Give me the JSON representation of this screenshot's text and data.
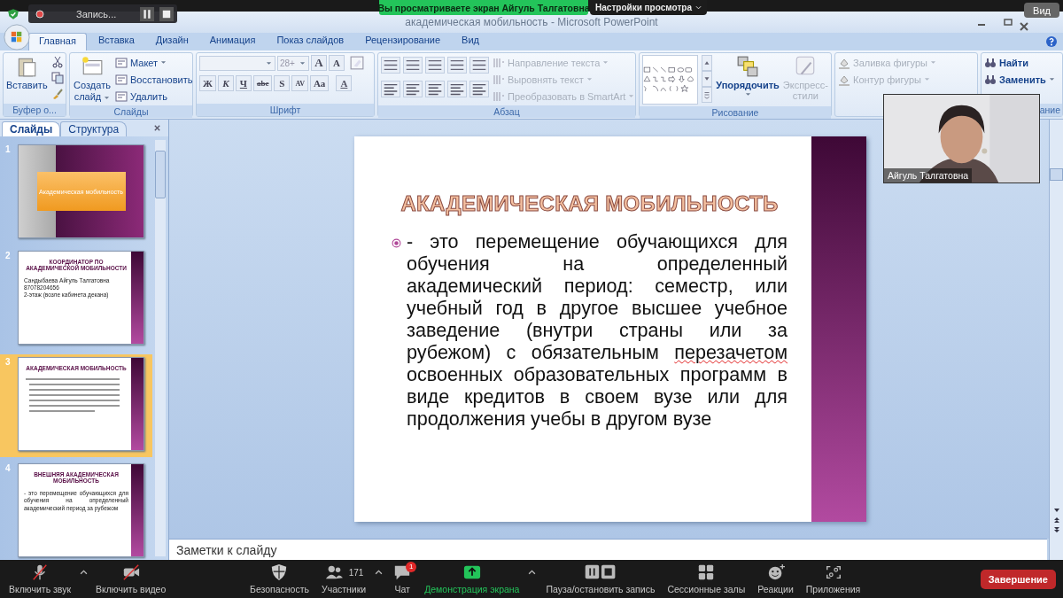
{
  "zoom_bar": {
    "banner": "Вы просматриваете экран Айгуль Талгатовна",
    "view_options": "Настройки просмотра",
    "view": "Вид"
  },
  "recording": {
    "label": "Запись..."
  },
  "window": {
    "title": "академическая мобильность - Microsoft PowerPoint"
  },
  "tabs": [
    {
      "label": "Главная",
      "selected": true
    },
    {
      "label": "Вставка",
      "selected": false
    },
    {
      "label": "Дизайн",
      "selected": false
    },
    {
      "label": "Анимация",
      "selected": false
    },
    {
      "label": "Показ слайдов",
      "selected": false
    },
    {
      "label": "Рецензирование",
      "selected": false
    },
    {
      "label": "Вид",
      "selected": false
    }
  ],
  "ribbon": {
    "clipboard": {
      "label": "Буфер о...",
      "paste": "Вставить"
    },
    "slides": {
      "label": "Слайды",
      "new_slide": "Создать слайд",
      "items": [
        {
          "label": "Макет",
          "dropdown": true
        },
        {
          "label": "Восстановить",
          "dropdown": false
        },
        {
          "label": "Удалить",
          "dropdown": false
        }
      ]
    },
    "font": {
      "label": "Шрифт",
      "size": "28+",
      "size_buttons": [
        "A",
        "A"
      ],
      "buttons": [
        "Ж",
        "К",
        "Ч",
        "abe",
        "S",
        "AV",
        "Aa",
        "A"
      ]
    },
    "paragraph": {
      "label": "Абзац",
      "items": [
        {
          "label": "Направление текста",
          "disabled": true
        },
        {
          "label": "Выровнять текст",
          "disabled": true
        },
        {
          "label": "Преобразовать в SmartArt",
          "disabled": true
        }
      ]
    },
    "drawing": {
      "label": "Рисование",
      "arrange": "Упорядочить",
      "quick_styles": {
        "label": "Экспресс-стили",
        "disabled": true
      },
      "items": [
        {
          "label": "Заливка фигуры",
          "disabled": true
        },
        {
          "label": "Контур фигуры",
          "disabled": true
        }
      ]
    },
    "editing": {
      "label": "ание",
      "items": [
        {
          "label": "Найти",
          "dropdown": false
        },
        {
          "label": "Заменить",
          "dropdown": true
        }
      ]
    }
  },
  "slides_pane": {
    "tabs": [
      {
        "label": "Слайды",
        "selected": true
      },
      {
        "label": "Структура",
        "selected": false
      }
    ],
    "thumbnails": [
      {
        "number": "1",
        "selected": false,
        "kind": "title",
        "subtitle": "Академическая мобильность"
      },
      {
        "number": "2",
        "selected": false,
        "kind": "content",
        "title": "КООРДИНАТОР ПО АКАДЕМИЧЕСКОЙ МОБИЛЬНОСТИ",
        "bullets": [
          "Сандыбаева Айгуль Талгатовна",
          "87078204656",
          "2-этаж (возле кабинета декана)"
        ]
      },
      {
        "number": "3",
        "selected": true,
        "kind": "content",
        "title": "АКАДЕМИЧЕСКАЯ МОБИЛЬНОСТЬ"
      },
      {
        "number": "4",
        "selected": false,
        "kind": "content",
        "title": "ВНЕШНЯЯ АКАДЕМИЧЕСКАЯ МОБИЛЬНОСТЬ",
        "bullets": [
          "- это перемещение обучающихся для обучения на определенный академический период за рубежом"
        ]
      }
    ]
  },
  "slide": {
    "title": "АКАДЕМИЧЕСКАЯ МОБИЛЬНОСТЬ",
    "body": [
      {
        "text": "- это перемещение обучающихся для обучения на определенный академический период:  семестр, или учебный год в другое высшее учебное заведение (внутри страны или за рубежом) с обязательным ",
        "spell_error": false
      },
      {
        "text": "перезачетом",
        "spell_error": true
      },
      {
        "text": "  освоенных образовательных программ в виде кредитов в своем вузе или для продолжения учебы в другом вузе",
        "spell_error": false
      }
    ]
  },
  "notes": {
    "text": "Заметки к слайду"
  },
  "video": {
    "name": "Айгуль Талгатовна"
  },
  "meeting_toolbar": {
    "items": [
      {
        "label": "Включить звук",
        "kind": "mic",
        "caret": true
      },
      {
        "label": "Включить видео",
        "kind": "video",
        "caret": false
      },
      {
        "label": "Безопасность",
        "kind": "security",
        "caret": false
      },
      {
        "label": "Участники",
        "kind": "participants",
        "count": "171",
        "caret": true
      },
      {
        "label": "Чат",
        "kind": "chat",
        "badge": "1",
        "caret": false
      },
      {
        "label": "Демонстрация экрана",
        "kind": "share",
        "caret": true
      },
      {
        "label": "Пауза/остановить запись",
        "kind": "record",
        "caret": false
      },
      {
        "label": "Сессионные залы",
        "kind": "rooms",
        "caret": false
      },
      {
        "label": "Реакции",
        "kind": "reactions",
        "caret": false
      },
      {
        "label": "Приложения",
        "kind": "apps",
        "caret": false
      }
    ],
    "end": "Завершение"
  }
}
